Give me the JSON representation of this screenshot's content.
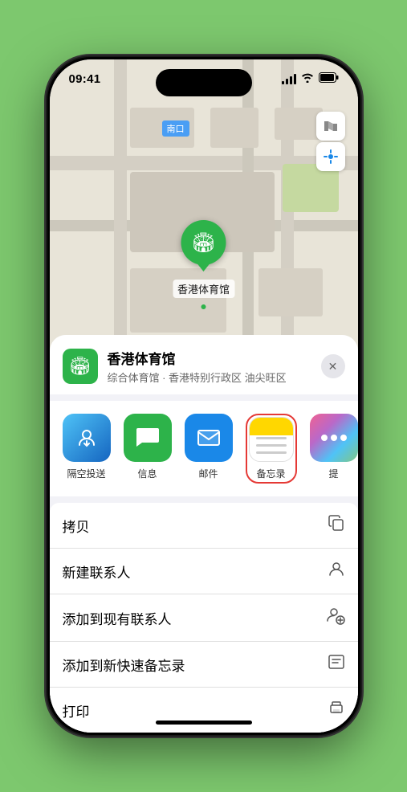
{
  "status": {
    "time": "09:41",
    "location_icon": "▶"
  },
  "map": {
    "label": "南口",
    "pin_label": "香港体育馆"
  },
  "venue": {
    "name": "香港体育馆",
    "subtitle": "综合体育馆 · 香港特别行政区 油尖旺区"
  },
  "share_items": [
    {
      "label": "隔空投送",
      "type": "airdrop"
    },
    {
      "label": "信息",
      "type": "message"
    },
    {
      "label": "邮件",
      "type": "mail"
    },
    {
      "label": "备忘录",
      "type": "notes"
    },
    {
      "label": "提",
      "type": "more"
    }
  ],
  "actions": [
    {
      "label": "拷贝",
      "icon": "📋"
    },
    {
      "label": "新建联系人",
      "icon": "👤"
    },
    {
      "label": "添加到现有联系人",
      "icon": "👤"
    },
    {
      "label": "添加到新快速备忘录",
      "icon": "🗒"
    },
    {
      "label": "打印",
      "icon": "🖨"
    }
  ],
  "buttons": {
    "close": "✕"
  }
}
